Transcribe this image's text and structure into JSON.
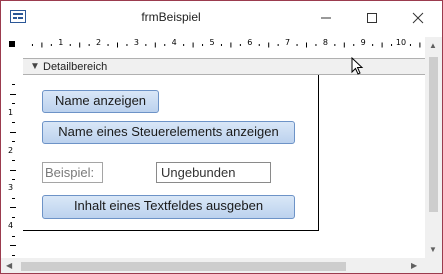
{
  "window": {
    "title": "frmBeispiel"
  },
  "ruler": {
    "numbers": [
      "1",
      "2",
      "3",
      "4",
      "5",
      "6",
      "7",
      "8",
      "9",
      "10"
    ],
    "vertical_numbers": [
      "1",
      "2",
      "3",
      "4"
    ]
  },
  "section": {
    "name": "Detailbereich"
  },
  "controls": {
    "btn_name_anzeigen": "Name anzeigen",
    "btn_name_steuerelement": "Name eines Steuerelements anzeigen",
    "label_beispiel": "Beispiel:",
    "textbox_ungebunden": "Ungebunden",
    "btn_inhalt_textfeld": "Inhalt eines Textfeldes ausgeben"
  },
  "icons": {
    "app": "form-icon",
    "minimize": "minimize-icon",
    "maximize": "maximize-icon",
    "close": "close-icon",
    "section_caret": "chevron-down-icon",
    "cursor": "mouse-pointer-icon"
  },
  "colors": {
    "window_border": "#9b3b4e",
    "button_fill": "#c9dcf3",
    "button_border": "#6d93c7"
  }
}
